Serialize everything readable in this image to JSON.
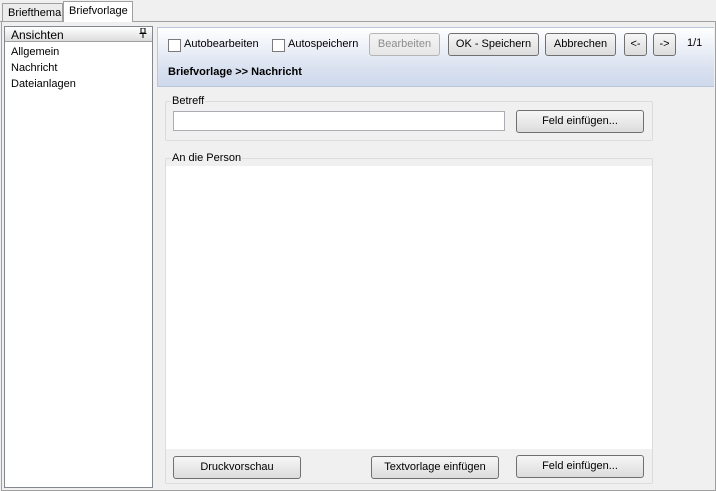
{
  "tabs": [
    {
      "label": "Briefthema",
      "active": false
    },
    {
      "label": "Briefvorlage",
      "active": true
    }
  ],
  "views_panel": {
    "title": "Ansichten",
    "pin_icon": "pin-icon",
    "items": [
      "Allgemein",
      "Nachricht",
      "Dateianlagen"
    ]
  },
  "toolbar": {
    "autobearbeiten_label": "Autobearbeiten",
    "autobearbeiten_checked": false,
    "autospeichern_label": "Autospeichern",
    "autospeichern_checked": false,
    "bearbeiten_label": "Bearbeiten",
    "ok_speichern_label": "OK - Speichern",
    "abbrechen_label": "Abbrechen",
    "prev_label": "<-",
    "next_label": "->",
    "record_counter": "1/1",
    "breadcrumb": "Briefvorlage >> Nachricht"
  },
  "betreff_group": {
    "label": "Betreff",
    "value": "",
    "insert_field_label": "Feld einfügen..."
  },
  "person_group": {
    "label": "An die Person",
    "value": "",
    "print_preview_label": "Druckvorschau",
    "insert_template_label": "Textvorlage einfügen",
    "insert_field_label": "Feld einfügen..."
  },
  "colors": {
    "toolbar_gradient_bottom": "#cfd9ec",
    "window_background": "#f0f0f0"
  }
}
